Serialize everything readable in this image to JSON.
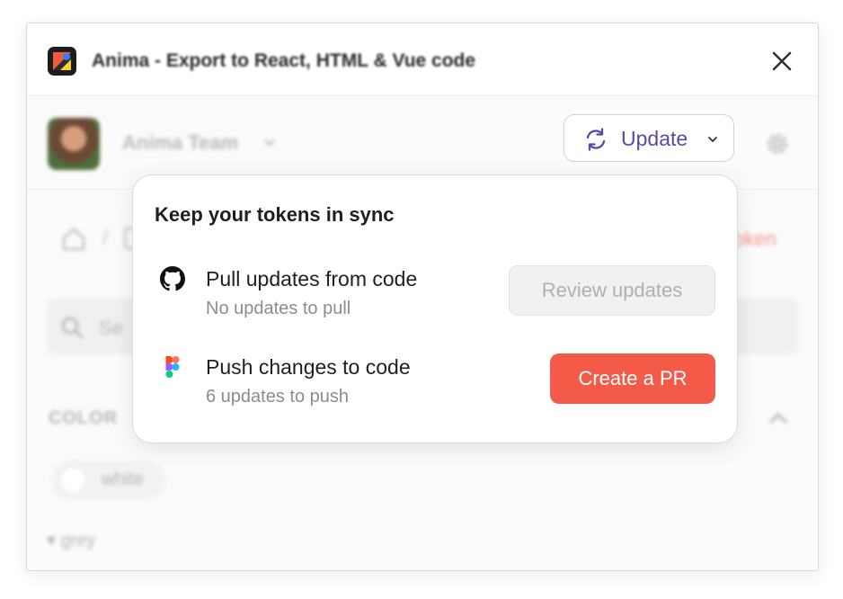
{
  "window": {
    "title": "Anima - Export to React, HTML & Vue code",
    "icon": "anima-logo-icon",
    "close_icon": "close-icon"
  },
  "header": {
    "team_name": "Anima Team",
    "update_button_label": "Update",
    "accent_color": "#5b48a8"
  },
  "background": {
    "token_link": "oken",
    "search_placeholder": "Se",
    "section_label": "COLOR",
    "chip_label": "white",
    "group_label": "grey"
  },
  "popover": {
    "title": "Keep your tokens in sync",
    "rows": [
      {
        "icon": "github-icon",
        "title": "Pull updates from code",
        "subtitle": "No updates to pull",
        "button_label": "Review updates",
        "button_enabled": false
      },
      {
        "icon": "figma-icon",
        "title": "Push changes to code",
        "subtitle": "6 updates to push",
        "button_label": "Create a PR",
        "button_enabled": true,
        "button_color": "#f35a47"
      }
    ]
  }
}
